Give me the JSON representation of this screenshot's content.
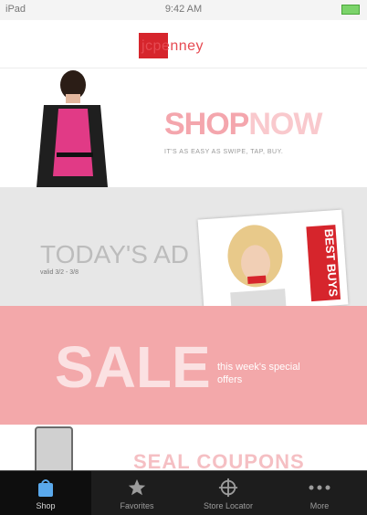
{
  "status": {
    "carrier": "iPad",
    "time": "9:42 AM"
  },
  "header": {
    "logo_text": "jcpenney"
  },
  "shop": {
    "title_shop": "SHOP",
    "title_now": "NOW",
    "subtitle": "IT'S AS EASY AS SWIPE, TAP, BUY."
  },
  "ad": {
    "title": "TODAY'S AD",
    "dates": "valid 3/2 - 3/8",
    "badge": "BEST BUYS"
  },
  "sale": {
    "title": "SALE",
    "subtitle": "this week's special offers"
  },
  "newsletter": {
    "title": "SEAL COUPONS"
  },
  "tabs": [
    {
      "label": "Shop",
      "icon": "bag-icon",
      "active": true
    },
    {
      "label": "Favorites",
      "icon": "star-icon"
    },
    {
      "label": "Store Locator",
      "icon": "crosshair-icon"
    },
    {
      "label": "More",
      "icon": "more-dots-icon"
    }
  ],
  "colors": {
    "brand_red": "#d6252c",
    "sale_pink": "#f3a8aa",
    "tab_bg": "#1d1d1d",
    "active_tab_icon": "#5aa9ec"
  }
}
